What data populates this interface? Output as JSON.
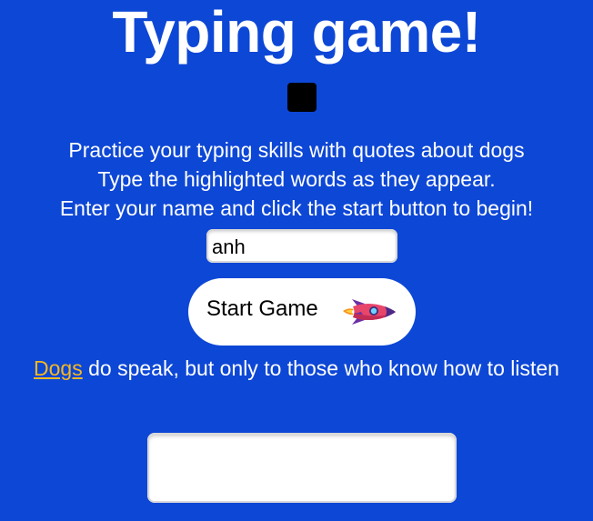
{
  "title": "Typing game!",
  "timer": {
    "color": "#000000"
  },
  "instructions": {
    "line1": "Practice your typing skills with quotes about dogs",
    "line2": "Type the highlighted words as they appear.",
    "line3": "Enter your name and click the start button to begin!"
  },
  "name_input": {
    "value": "anh",
    "placeholder": ""
  },
  "start_button": {
    "label": "Start Game",
    "icon": "rocket-icon"
  },
  "quote": {
    "highlighted_word": "Dogs",
    "rest": " do speak, but only to those who know how to listen"
  },
  "answer_input": {
    "value": "",
    "placeholder": ""
  },
  "colors": {
    "background": "#0d47d6",
    "highlight": "#f5b820",
    "text": "#ffffff"
  }
}
